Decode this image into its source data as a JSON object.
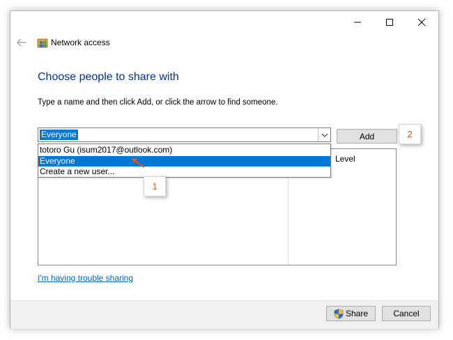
{
  "window": {
    "title": "Network access",
    "heading": "Choose people to share with",
    "instruction": "Type a name and then click Add, or click the arrow to find someone."
  },
  "combo": {
    "value": "Everyone",
    "options": [
      "totoro Gu (isum2017@outlook.com)",
      "Everyone",
      "Create a new user..."
    ],
    "selected_index": 1
  },
  "add_button": "Add",
  "table": {
    "level_header": "Level"
  },
  "help_link": "I'm having trouble sharing",
  "footer": {
    "share_label": "Share",
    "cancel_label": "Cancel"
  },
  "callouts": {
    "one": "1",
    "two": "2"
  },
  "colors": {
    "heading": "#003399",
    "selection": "#0078d7",
    "link": "#0066cc",
    "callout_text": "#e0561b",
    "arrow": "#e0561b"
  },
  "icons": [
    "back-arrow-icon",
    "network-people-icon",
    "minimize-icon",
    "maximize-icon",
    "close-icon",
    "chevron-down-icon",
    "uac-shield-icon"
  ]
}
